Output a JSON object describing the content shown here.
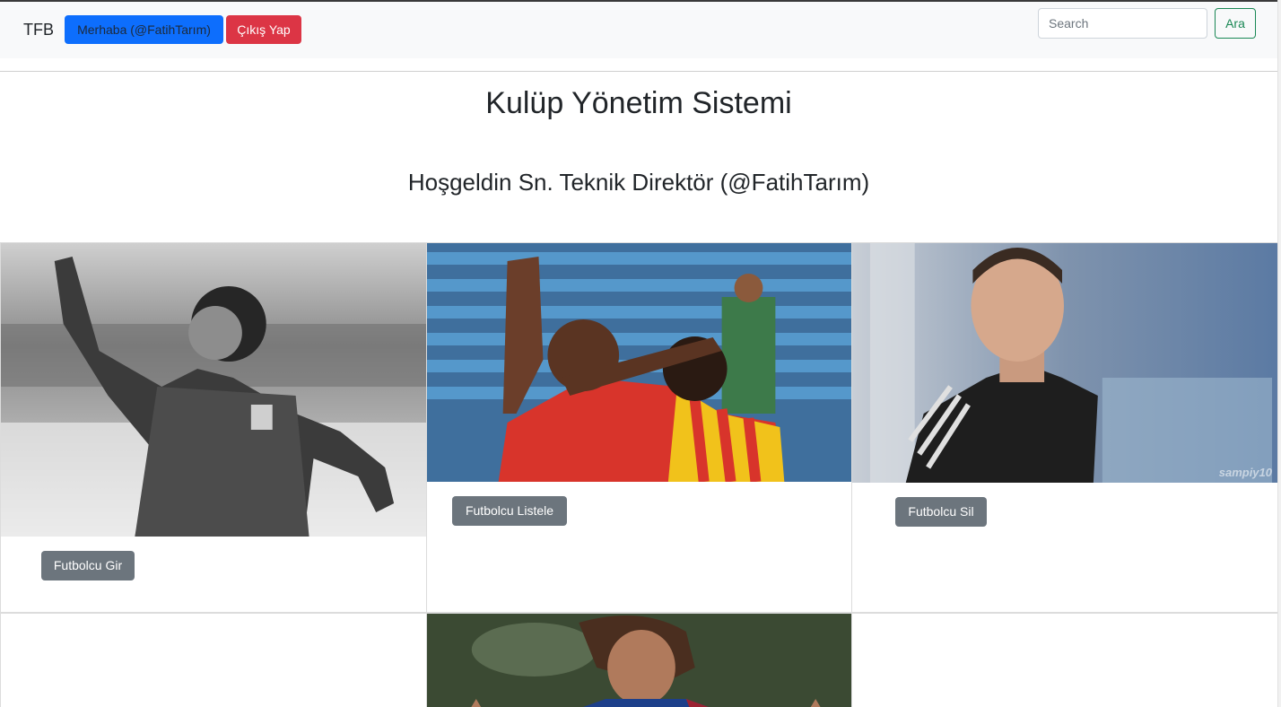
{
  "navbar": {
    "brand": "TFB",
    "greeting_button": "Merhaba (@FatihTarım)",
    "logout_button": "Çıkış Yap",
    "search_placeholder": "Search",
    "search_button": "Ara"
  },
  "main": {
    "title": "Kulüp Yönetim Sistemi",
    "welcome": "Hoşgeldin Sn. Teknik Direktör (@FatihTarım)"
  },
  "cards": [
    {
      "button": "Futbolcu Gir",
      "photo_watermark": ""
    },
    {
      "button": "Futbolcu Listele",
      "photo_watermark": ""
    },
    {
      "button": "Futbolcu Sil",
      "photo_watermark": "sampiy10"
    }
  ],
  "colors": {
    "primary": "#0d6efd",
    "danger": "#dc3545",
    "success": "#198754",
    "secondary": "#6c757d",
    "navbar_bg": "#f8f9fa"
  }
}
